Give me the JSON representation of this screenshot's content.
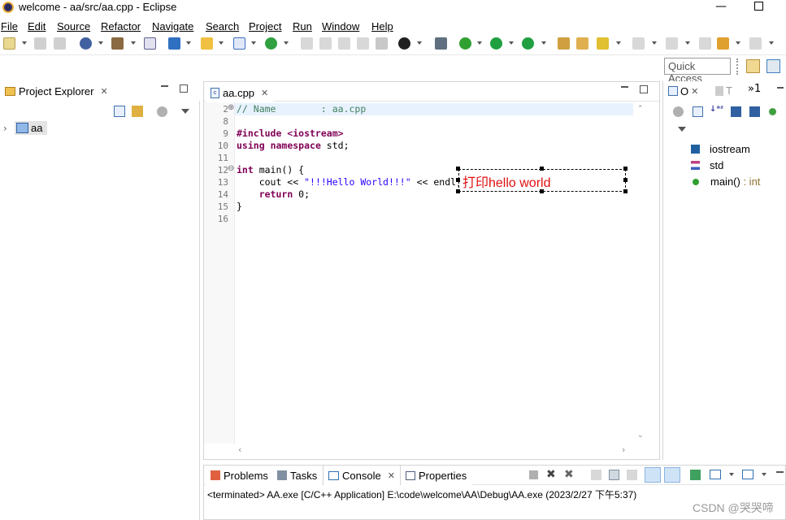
{
  "window": {
    "title": "welcome - aa/src/aa.cpp - Eclipse",
    "minimize": "—"
  },
  "menu": [
    "File",
    "Edit",
    "Source",
    "Refactor",
    "Navigate",
    "Search",
    "Project",
    "Run",
    "Window",
    "Help"
  ],
  "quick_access": {
    "placeholder": "Quick Access"
  },
  "project_explorer": {
    "tab_label": "Project Explorer",
    "close": "✕",
    "tree": [
      {
        "label": "aa"
      }
    ]
  },
  "editor": {
    "tab_label": "aa.cpp",
    "close": "✕",
    "lines": [
      {
        "num": "2",
        "marker": "⊕",
        "text": "// Name        : aa.cpp"
      },
      {
        "num": "8",
        "text": ""
      },
      {
        "num": "9",
        "text": "#include <iostream>"
      },
      {
        "num": "10",
        "text": "using namespace std;"
      },
      {
        "num": "11",
        "text": ""
      },
      {
        "num": "12",
        "marker": "⊖",
        "text": "int main() {"
      },
      {
        "num": "13",
        "text": "    cout << \"!!!Hello World!!!\" << endl;"
      },
      {
        "num": "14",
        "text": "    return 0;"
      },
      {
        "num": "15",
        "text": "}"
      },
      {
        "num": "16",
        "text": ""
      }
    ],
    "annotation": "打印hello world"
  },
  "outline": {
    "tab_label": "O",
    "second_tab": "T",
    "overflow": "»1",
    "items": [
      {
        "label": "iostream",
        "kind": "include"
      },
      {
        "label": "std",
        "kind": "namespace"
      },
      {
        "label": "main()",
        "suffix": " : int",
        "kind": "function"
      }
    ]
  },
  "console": {
    "tabs": [
      {
        "label": "Problems"
      },
      {
        "label": "Tasks"
      },
      {
        "label": "Console",
        "active": true,
        "close": "✕"
      },
      {
        "label": "Properties"
      }
    ],
    "status": "<terminated> AA.exe [C/C++ Application] E:\\code\\welcome\\AA\\Debug\\AA.exe (2023/2/27 下午5:37)"
  },
  "watermark": "CSDN @哭哭啼"
}
